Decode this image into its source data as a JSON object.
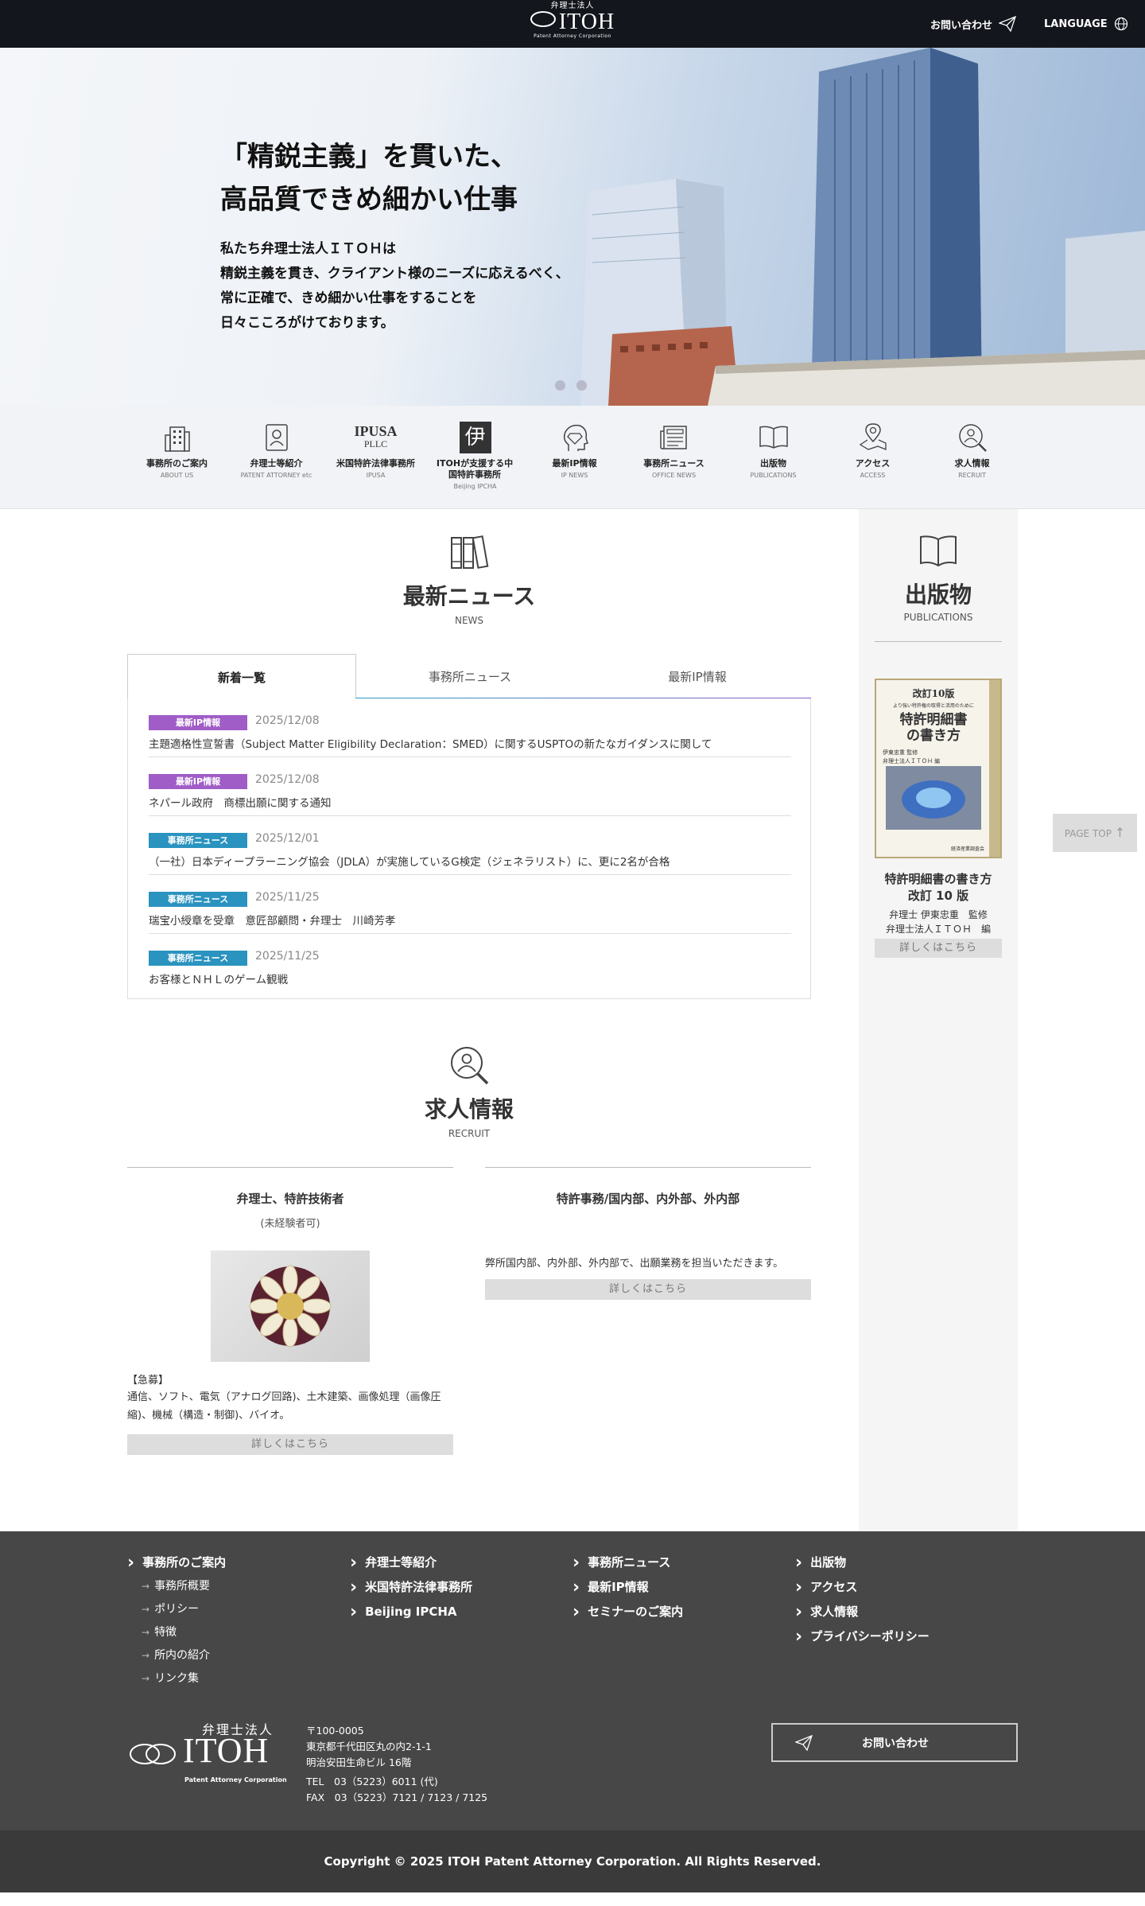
{
  "header": {
    "logo_small": "弁理士法人",
    "logo_big": "ITOH",
    "logo_tiny": "Patent Attorney Corporation",
    "contact_label": "お問い合わせ",
    "language_label": "LANGUAGE"
  },
  "hero": {
    "headline_1": "「精鋭主義」を貫いた、",
    "headline_2": "高品質できめ細かい仕事",
    "body_1": "私たち弁理士法人ＩＴＯＨは",
    "body_2": "精鋭主義を貫き、クライアント様のニーズに応えるべく、",
    "body_3": "常に正確で、きめ細かい仕事をすることを",
    "body_4": "日々こころがけております。"
  },
  "nav": {
    "items": [
      {
        "ja": "事務所のご案内",
        "en": "ABOUT US",
        "icon": "building-icon"
      },
      {
        "ja": "弁理士等紹介",
        "en": "PATENT ATTORNEY etc",
        "icon": "profile-icon"
      },
      {
        "ja": "米国特許法律事務所",
        "en": "IPUSA",
        "icon": "ipusa-logo"
      },
      {
        "ja": "ITOHが支援する中国特許事務所",
        "en": "Beijing IPCHA",
        "icon": "ipcha-logo"
      },
      {
        "ja": "最新IP情報",
        "en": "IP NEWS",
        "icon": "diamond-head-icon"
      },
      {
        "ja": "事務所ニュース",
        "en": "OFFICE NEWS",
        "icon": "newspaper-icon"
      },
      {
        "ja": "出版物",
        "en": "PUBLICATIONS",
        "icon": "book-icon"
      },
      {
        "ja": "アクセス",
        "en": "ACCESS",
        "icon": "map-pin-icon"
      },
      {
        "ja": "求人情報",
        "en": "RECRUIT",
        "icon": "search-person-icon"
      }
    ],
    "ipusa_logo_text": "IPUSA",
    "ipusa_logo_sub": "PLLC",
    "ipcha_logo_text": "伊"
  },
  "news": {
    "title": "最新ニュース",
    "en": "NEWS",
    "tabs": [
      "新着一覧",
      "事務所ニュース",
      "最新IP情報"
    ],
    "items": [
      {
        "category": "最新IP情報",
        "color": "#a05cc7",
        "date": "2025/12/08",
        "title": "主題適格性宣誓書（Subject Matter Eligibility Declaration：SMED）に関するUSPTOの新たなガイダンスに関して"
      },
      {
        "category": "最新IP情報",
        "color": "#a05cc7",
        "date": "2025/12/08",
        "title": "ネパール政府　商標出願に関する通知"
      },
      {
        "category": "事務所ニュース",
        "color": "#2a93bf",
        "date": "2025/12/01",
        "title": "（一社）日本ディープラーニング協会（JDLA）が実施しているG検定（ジェネラリスト）に、更に2名が合格"
      },
      {
        "category": "事務所ニュース",
        "color": "#2a93bf",
        "date": "2025/11/25",
        "title": "瑞宝小綬章を受章　意匠部顧問・弁理士　川崎芳孝"
      },
      {
        "category": "事務所ニュース",
        "color": "#2a93bf",
        "date": "2025/11/25",
        "title": "お客様とＮＨＬのゲーム観戦"
      }
    ]
  },
  "publications": {
    "title": "出版物",
    "en": "PUBLICATIONS",
    "book_cover_top": "改訂10版",
    "book_cover_sub": "より強い特許権の取得と活用のために",
    "book_cover_title_1": "特許明細書",
    "book_cover_title_2": "の書き方",
    "book_cover_author_1": "伊東忠重 監修",
    "book_cover_author_2": "弁理士法人ＩＴＯＨ 編",
    "book_cover_publisher": "経済産業調査会",
    "book_title_1": "特許明細書の書き方",
    "book_title_2": "改訂 10 版",
    "author_1": "弁理士 伊東忠重　監修",
    "author_2": "弁理士法人ＩＴＯＨ　編",
    "detail_label": "詳しくはこちら"
  },
  "recruit": {
    "title": "求人情報",
    "en": "RECRUIT",
    "col1": {
      "title": "弁理士、特許技術者",
      "sub": "(未経験者可)",
      "urgent": "【急募】",
      "desc": "通信、ソフト、電気（アナログ回路)、土木建築、画像処理（画像圧縮)、機械（構造・制御)、バイオ。",
      "detail_label": "詳しくはこちら"
    },
    "col2": {
      "title": "特許事務/国内部、内外部、外内部",
      "desc": "弊所国内部、内外部、外内部で、出願業務を担当いただきます。",
      "detail_label": "詳しくはこちら"
    }
  },
  "footer": {
    "col1_main": "事務所のご案内",
    "col1_subs": [
      "事務所概要",
      "ポリシー",
      "特徴",
      "所内の紹介",
      "リンク集"
    ],
    "col2": [
      "弁理士等紹介",
      "米国特許法律事務所",
      "Beijing IPCHA"
    ],
    "col3": [
      "事務所ニュース",
      "最新IP情報",
      "セミナーのご案内"
    ],
    "col4": [
      "出版物",
      "アクセス",
      "求人情報",
      "プライバシーポリシー"
    ],
    "logo_small": "弁理士法人",
    "logo_big": "ITOH",
    "logo_tiny": "Patent Attorney Corporation",
    "address": [
      "〒100-0005",
      "東京都千代田区丸の内2-1-1",
      "明治安田生命ビル 16階"
    ],
    "tel": "TEL　03（5223）6011 (代)",
    "fax": "FAX　03（5223）7121 / 7123 / 7125",
    "contact_label": "お問い合わせ"
  },
  "copyright": "Copyright © 2025 ITOH Patent Attorney Corporation. All Rights Reserved.",
  "page_top": "PAGE TOP"
}
